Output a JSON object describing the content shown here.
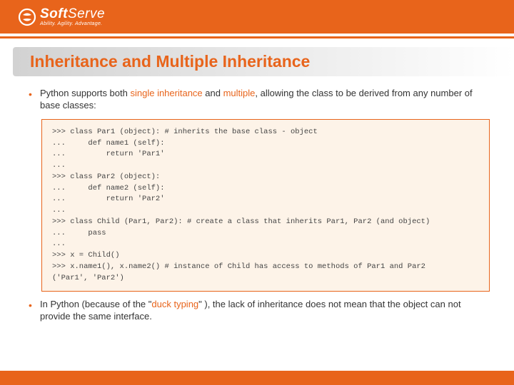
{
  "logo": {
    "name_prefix": "Soft",
    "name_suffix": "Serve",
    "tagline": "Ability. Agility. Advantage."
  },
  "title": "Inheritance and Multiple Inheritance",
  "bullets": [
    {
      "parts": [
        {
          "t": "Python supports both ",
          "cls": ""
        },
        {
          "t": "single inheritance",
          "cls": "orange-text"
        },
        {
          "t": " and ",
          "cls": ""
        },
        {
          "t": "multiple",
          "cls": "orange-text"
        },
        {
          "t": ", allowing the class to be derived from any number of base classes:",
          "cls": ""
        }
      ]
    },
    {
      "parts": [
        {
          "t": "In Python (because of the \"",
          "cls": ""
        },
        {
          "t": "duck typing",
          "cls": "orange-text"
        },
        {
          "t": "\" ), the lack of inheritance does not mean that the object can not provide the same interface.",
          "cls": ""
        }
      ]
    }
  ],
  "code": ">>> class Par1 (object): # inherits the base class - object\n...     def name1 (self):\n...         return 'Par1'\n...\n>>> class Par2 (object):\n...     def name2 (self):\n...         return 'Par2'\n...\n>>> class Child (Par1, Par2): # create a class that inherits Par1, Par2 (and object)\n...     pass\n...\n>>> x = Child()\n>>> x.name1(), x.name2() # instance of Child has access to methods of Par1 and Par2\n('Par1', 'Par2')"
}
